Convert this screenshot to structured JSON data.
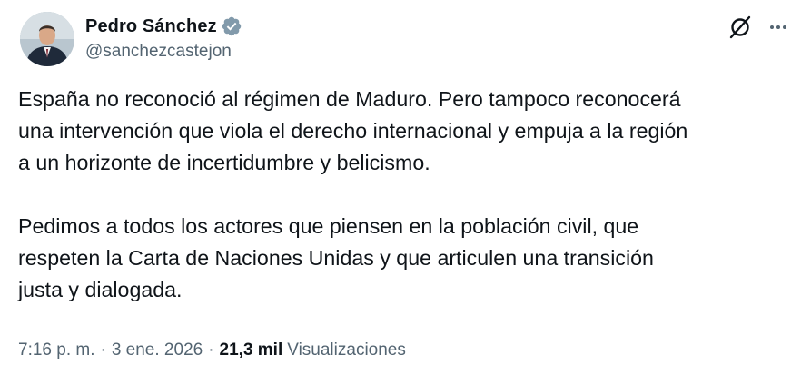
{
  "author": {
    "display_name": "Pedro Sánchez",
    "handle": "@sanchezcastejon",
    "verified": true,
    "badge_color": "#829aab"
  },
  "tweet": {
    "text": "España no reconoció al régimen de Maduro. Pero tampoco reconocerá\nuna intervención que viola el derecho internacional y empuja a la región\na un horizonte de incertidumbre y belicismo.\n\nPedimos a todos los actores que piensen en la población civil, que\nrespeten la Carta de Naciones Unidas y que articulen una transición\njusta y dialogada."
  },
  "meta": {
    "time": "7:16 p. m.",
    "separator": "·",
    "date": "3 ene. 2026",
    "views_count": "21,3 mil",
    "views_label": "Visualizaciones"
  },
  "icons": {
    "grok": "grok-icon",
    "more": "more-options-icon",
    "verified": "verified-badge-icon"
  },
  "colors": {
    "text_primary": "#0f1419",
    "text_secondary": "#536471",
    "background": "#ffffff"
  }
}
